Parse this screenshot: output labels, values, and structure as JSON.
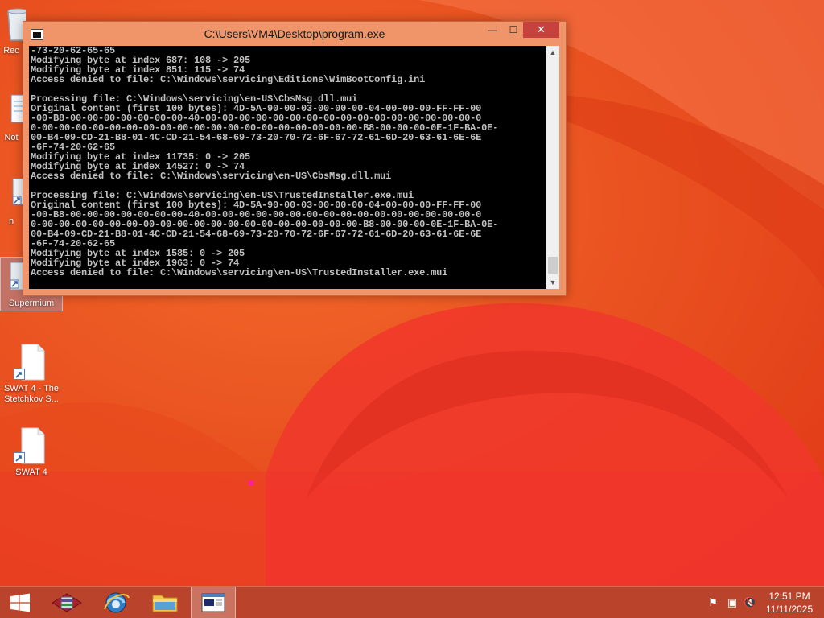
{
  "window": {
    "title": "C:\\Users\\VM4\\Desktop\\program.exe",
    "minimize_glyph": "—",
    "maximize_glyph": "☐",
    "close_glyph": "✕"
  },
  "console": {
    "lines": [
      "-73-20-62-65-65",
      "Modifying byte at index 687: 108 -> 205",
      "Modifying byte at index 851: 115 -> 74",
      "Access denied to file: C:\\Windows\\servicing\\Editions\\WimBootConfig.ini",
      "",
      "Processing file: C:\\Windows\\servicing\\en-US\\CbsMsg.dll.mui",
      "Original content (first 100 bytes): 4D-5A-90-00-03-00-00-00-04-00-00-00-FF-FF-00",
      "-00-B8-00-00-00-00-00-00-00-40-00-00-00-00-00-00-00-00-00-00-00-00-00-00-00-00-0",
      "0-00-00-00-00-00-00-00-00-00-00-00-00-00-00-00-00-00-00-00-B8-00-00-00-0E-1F-BA-0E-",
      "00-B4-09-CD-21-B8-01-4C-CD-21-54-68-69-73-20-70-72-6F-67-72-61-6D-20-63-61-6E-6E",
      "-6F-74-20-62-65",
      "Modifying byte at index 11735: 0 -> 205",
      "Modifying byte at index 14527: 0 -> 74",
      "Access denied to file: C:\\Windows\\servicing\\en-US\\CbsMsg.dll.mui",
      "",
      "Processing file: C:\\Windows\\servicing\\en-US\\TrustedInstaller.exe.mui",
      "Original content (first 100 bytes): 4D-5A-90-00-03-00-00-00-04-00-00-00-FF-FF-00",
      "-00-B8-00-00-00-00-00-00-00-40-00-00-00-00-00-00-00-00-00-00-00-00-00-00-00-00-0",
      "0-00-00-00-00-00-00-00-00-00-00-00-00-00-00-00-00-00-00-00-B8-00-00-00-0E-1F-BA-0E-",
      "00-B4-09-CD-21-B8-01-4C-CD-21-54-68-69-73-20-70-72-6F-67-72-61-6D-20-63-61-6E-6E",
      "-6F-74-20-62-65",
      "Modifying byte at index 1585: 0 -> 205",
      "Modifying byte at index 1963: 0 -> 74",
      "Access denied to file: C:\\Windows\\servicing\\en-US\\TrustedInstaller.exe.mui"
    ],
    "text_color": "#c0c0c0",
    "background": "#000000"
  },
  "desktop": {
    "icons": [
      {
        "label": "Rec",
        "name": "recycle-bin"
      },
      {
        "label": "Not",
        "name": "notepad"
      },
      {
        "label": "n",
        "name": "app"
      },
      {
        "label": "Supermium",
        "name": "supermium",
        "selected": true
      },
      {
        "label": "SWAT 4 - The Stetchkov S...",
        "name": "swat4-stetchkov"
      },
      {
        "label": "SWAT 4",
        "name": "swat4"
      }
    ]
  },
  "taskbar": {
    "items": [
      {
        "name": "start-button",
        "icon": "windows-logo-icon"
      },
      {
        "name": "winrar",
        "icon": "archive-icon"
      },
      {
        "name": "internet-explorer",
        "icon": "browser-icon"
      },
      {
        "name": "file-explorer",
        "icon": "folder-icon"
      },
      {
        "name": "program-exe",
        "icon": "console-icon",
        "active": true
      }
    ],
    "tray": {
      "flag_glyph": "⚑",
      "network_glyph": "▣",
      "volume_glyph": "🔇",
      "time": "12:51 PM",
      "date": "11/11/2025"
    }
  },
  "colors": {
    "wallpaper_base": "#e8461a",
    "taskbar": "#b9442b",
    "window_frame": "#f0956a",
    "close_button": "#c7413d"
  }
}
